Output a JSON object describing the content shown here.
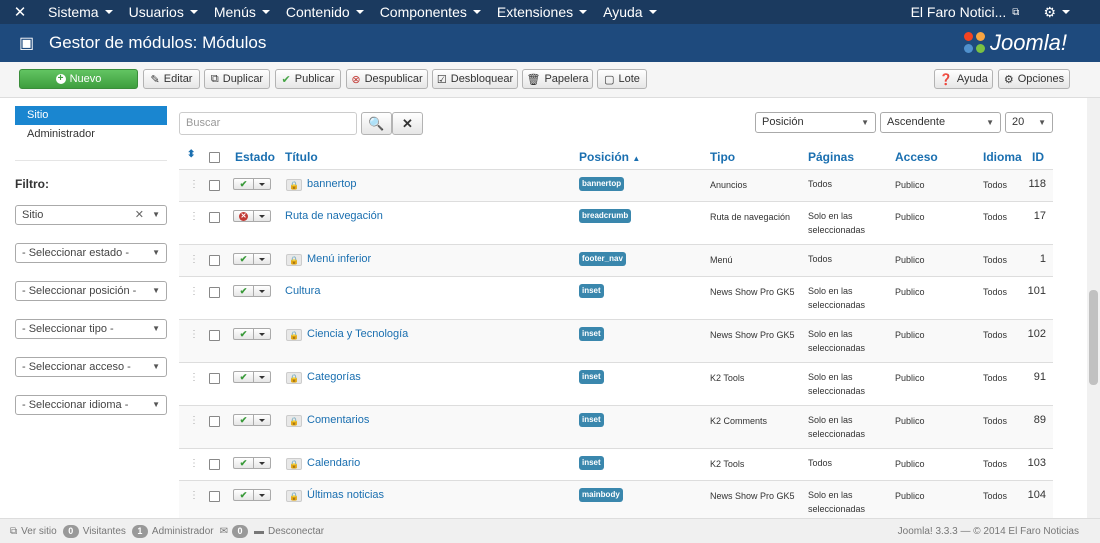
{
  "nav": {
    "menus": [
      "Sistema",
      "Usuarios",
      "Menús",
      "Contenido",
      "Componentes",
      "Extensiones",
      "Ayuda"
    ],
    "site_name": "El Faro Notici..."
  },
  "header": {
    "title": "Gestor de módulos: Módulos",
    "logo_text": "Joomla!"
  },
  "toolbar": {
    "nuevo": "Nuevo",
    "editar": "Editar",
    "duplicar": "Duplicar",
    "publicar": "Publicar",
    "despublicar": "Despublicar",
    "desbloquear": "Desbloquear",
    "papelera": "Papelera",
    "lote": "Lote",
    "ayuda": "Ayuda",
    "opciones": "Opciones"
  },
  "sidebar": {
    "links": [
      "Sitio",
      "Administrador"
    ],
    "filter_label": "Filtro:",
    "client_select": "Sitio",
    "filters": [
      "- Seleccionar estado -",
      "- Seleccionar posición -",
      "- Seleccionar tipo -",
      "- Seleccionar acceso -",
      "- Seleccionar idioma -"
    ]
  },
  "search": {
    "placeholder": "Buscar"
  },
  "list_controls": {
    "order_by": "Posición",
    "direction": "Ascendente",
    "limit": "20"
  },
  "table": {
    "headers": {
      "estado": "Estado",
      "titulo": "Título",
      "posicion": "Posición",
      "tipo": "Tipo",
      "paginas": "Páginas",
      "acceso": "Acceso",
      "idioma": "Idioma",
      "id": "ID"
    },
    "rows": [
      {
        "title": "bannertop",
        "published": true,
        "locked": true,
        "position": "bannertop",
        "type": "Anuncios",
        "pages": [
          "Todos"
        ],
        "access": "Publico",
        "language": "Todos",
        "id": "118"
      },
      {
        "title": "Ruta de navegación",
        "published": false,
        "locked": false,
        "position": "breadcrumb",
        "type": "Ruta de navegación",
        "pages": [
          "Solo en las",
          "seleccionadas"
        ],
        "access": "Publico",
        "language": "Todos",
        "id": "17"
      },
      {
        "title": "Menú inferior",
        "published": true,
        "locked": true,
        "position": "footer_nav",
        "type": "Menú",
        "pages": [
          "Todos"
        ],
        "access": "Publico",
        "language": "Todos",
        "id": "1"
      },
      {
        "title": "Cultura",
        "published": true,
        "locked": false,
        "position": "inset",
        "type": "News Show Pro GK5",
        "pages": [
          "Solo en las",
          "seleccionadas"
        ],
        "access": "Publico",
        "language": "Todos",
        "id": "101"
      },
      {
        "title": "Ciencia y Tecnología",
        "published": true,
        "locked": true,
        "position": "inset",
        "type": "News Show Pro GK5",
        "pages": [
          "Solo en las",
          "seleccionadas"
        ],
        "access": "Publico",
        "language": "Todos",
        "id": "102"
      },
      {
        "title": "Categorías",
        "published": true,
        "locked": true,
        "position": "inset",
        "type": "K2 Tools",
        "pages": [
          "Solo en las",
          "seleccionadas"
        ],
        "access": "Publico",
        "language": "Todos",
        "id": "91"
      },
      {
        "title": "Comentarios",
        "published": true,
        "locked": true,
        "position": "inset",
        "type": "K2 Comments",
        "pages": [
          "Solo en las",
          "seleccionadas"
        ],
        "access": "Publico",
        "language": "Todos",
        "id": "89"
      },
      {
        "title": "Calendario",
        "published": true,
        "locked": true,
        "position": "inset",
        "type": "K2 Tools",
        "pages": [
          "Todos"
        ],
        "access": "Publico",
        "language": "Todos",
        "id": "103"
      },
      {
        "title": "Últimas noticias",
        "published": true,
        "locked": true,
        "position": "mainbody",
        "type": "News Show Pro GK5",
        "pages": [
          "Solo en las",
          "seleccionadas"
        ],
        "access": "Publico",
        "language": "Todos",
        "id": "104"
      }
    ]
  },
  "status": {
    "ver_sitio": "Ver sitio",
    "visitors_count": "0",
    "visitors_label": "Visitantes",
    "admin_count": "1",
    "admin_label": "Administrador",
    "messages_count": "0",
    "logout": "Desconectar",
    "footer": "Joomla! 3.3.3 — © 2014 El Faro Noticias"
  },
  "colors": {
    "navbar": "#1b3a5f",
    "header": "#1e4a7d",
    "link": "#1a6fb0",
    "badge": "#3a87ad",
    "primary": "#46a546",
    "unpublished": "#c23b36"
  }
}
